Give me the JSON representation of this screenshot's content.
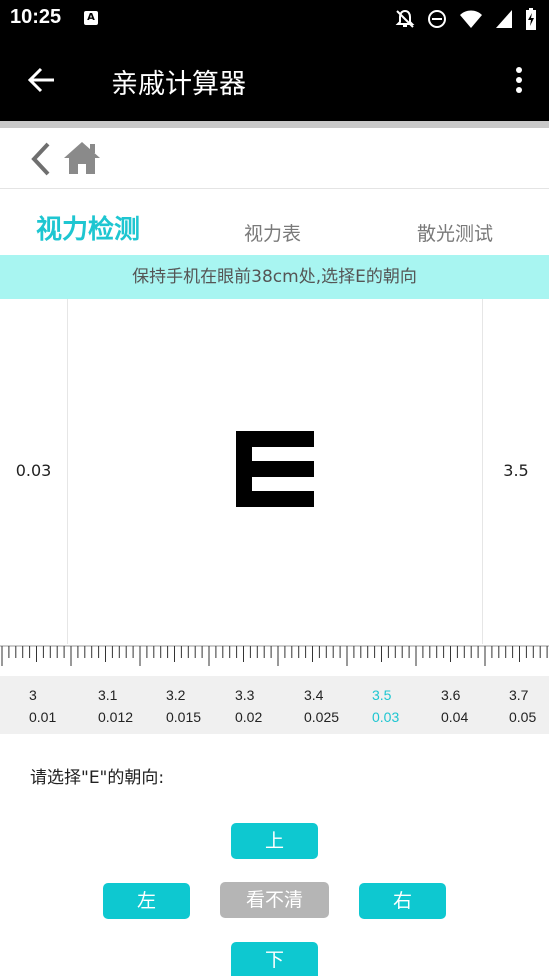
{
  "status_bar": {
    "time": "10:25",
    "a_badge": "A",
    "icons": [
      "notification-off-icon",
      "do-not-disturb-icon",
      "wifi-icon",
      "signal-icon",
      "battery-charging-icon"
    ]
  },
  "app_bar": {
    "title": "亲戚计算器",
    "back_icon": "arrow-left-icon",
    "menu_icon": "more-vertical-icon"
  },
  "nav": {
    "back_icon": "chevron-left-icon",
    "home_icon": "home-icon"
  },
  "tabs": [
    {
      "label": "视力检测",
      "active": true
    },
    {
      "label": "视力表",
      "active": false
    },
    {
      "label": "散光测试",
      "active": false
    }
  ],
  "hint": "保持手机在眼前38cm处,选择E的朝向",
  "test": {
    "left_value": "0.03",
    "right_value": "3.5",
    "symbol": "E"
  },
  "scale": [
    {
      "top": "3",
      "bottom": "0.01",
      "selected": false
    },
    {
      "top": "3.1",
      "bottom": "0.012",
      "selected": false
    },
    {
      "top": "3.2",
      "bottom": "0.015",
      "selected": false
    },
    {
      "top": "3.3",
      "bottom": "0.02",
      "selected": false
    },
    {
      "top": "3.4",
      "bottom": "0.025",
      "selected": false
    },
    {
      "top": "3.5",
      "bottom": "0.03",
      "selected": true
    },
    {
      "top": "3.6",
      "bottom": "0.04",
      "selected": false
    },
    {
      "top": "3.7",
      "bottom": "0.05",
      "selected": false
    }
  ],
  "prompt": "请选择\"E\"的朝向:",
  "buttons": {
    "up": "上",
    "left": "左",
    "unclear": "看不清",
    "right": "右",
    "down": "下"
  },
  "colors": {
    "accent": "#1ec6d1",
    "button": "#0ec8d0",
    "hint_bg": "#a8f5f1",
    "button_disabled": "#b5b5b5"
  }
}
